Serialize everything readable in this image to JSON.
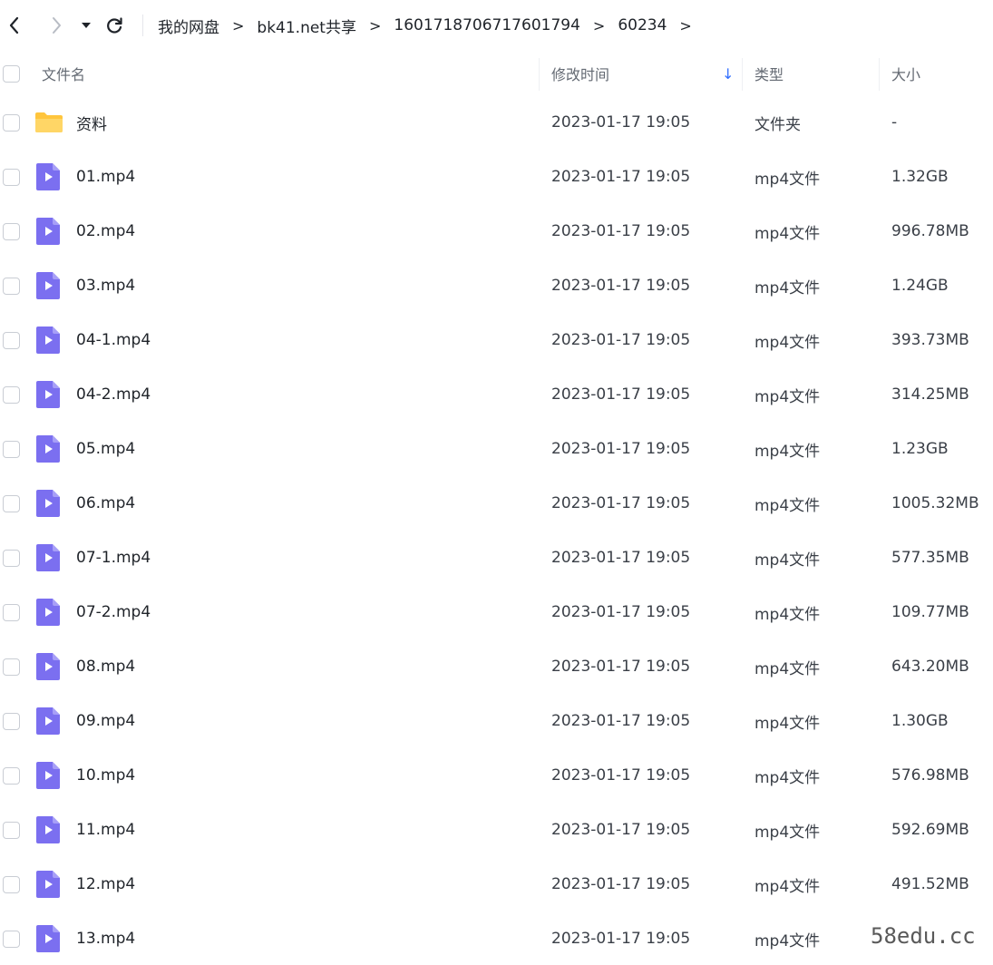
{
  "toolbar": {
    "back_icon": "chevron-left-icon",
    "forward_icon": "chevron-right-icon",
    "history_icon": "caret-down-icon",
    "refresh_icon": "refresh-icon"
  },
  "breadcrumb": {
    "items": [
      "我的网盘",
      "bk41.net共享",
      "1601718706717601794",
      "60234"
    ],
    "separator": ">"
  },
  "header": {
    "name": "文件名",
    "modified": "修改时间",
    "sort_icon": "arrow-down-icon",
    "sort_indicator": "↓",
    "type": "类型",
    "size": "大小"
  },
  "colors": {
    "accent": "#3370ff",
    "folder": "#ffc53d",
    "video_icon": "#7b6ff0"
  },
  "files": [
    {
      "name": "资料",
      "icon": "folder-icon",
      "modified": "2023-01-17 19:05",
      "type": "文件夹",
      "size": "-"
    },
    {
      "name": "01.mp4",
      "icon": "video-file-icon",
      "modified": "2023-01-17 19:05",
      "type": "mp4文件",
      "size": "1.32GB"
    },
    {
      "name": "02.mp4",
      "icon": "video-file-icon",
      "modified": "2023-01-17 19:05",
      "type": "mp4文件",
      "size": "996.78MB"
    },
    {
      "name": "03.mp4",
      "icon": "video-file-icon",
      "modified": "2023-01-17 19:05",
      "type": "mp4文件",
      "size": "1.24GB"
    },
    {
      "name": "04-1.mp4",
      "icon": "video-file-icon",
      "modified": "2023-01-17 19:05",
      "type": "mp4文件",
      "size": "393.73MB"
    },
    {
      "name": "04-2.mp4",
      "icon": "video-file-icon",
      "modified": "2023-01-17 19:05",
      "type": "mp4文件",
      "size": "314.25MB"
    },
    {
      "name": "05.mp4",
      "icon": "video-file-icon",
      "modified": "2023-01-17 19:05",
      "type": "mp4文件",
      "size": "1.23GB"
    },
    {
      "name": "06.mp4",
      "icon": "video-file-icon",
      "modified": "2023-01-17 19:05",
      "type": "mp4文件",
      "size": "1005.32MB"
    },
    {
      "name": "07-1.mp4",
      "icon": "video-file-icon",
      "modified": "2023-01-17 19:05",
      "type": "mp4文件",
      "size": "577.35MB"
    },
    {
      "name": "07-2.mp4",
      "icon": "video-file-icon",
      "modified": "2023-01-17 19:05",
      "type": "mp4文件",
      "size": "109.77MB"
    },
    {
      "name": "08.mp4",
      "icon": "video-file-icon",
      "modified": "2023-01-17 19:05",
      "type": "mp4文件",
      "size": "643.20MB"
    },
    {
      "name": "09.mp4",
      "icon": "video-file-icon",
      "modified": "2023-01-17 19:05",
      "type": "mp4文件",
      "size": "1.30GB"
    },
    {
      "name": "10.mp4",
      "icon": "video-file-icon",
      "modified": "2023-01-17 19:05",
      "type": "mp4文件",
      "size": "576.98MB"
    },
    {
      "name": "11.mp4",
      "icon": "video-file-icon",
      "modified": "2023-01-17 19:05",
      "type": "mp4文件",
      "size": "592.69MB"
    },
    {
      "name": "12.mp4",
      "icon": "video-file-icon",
      "modified": "2023-01-17 19:05",
      "type": "mp4文件",
      "size": "491.52MB"
    },
    {
      "name": "13.mp4",
      "icon": "video-file-icon",
      "modified": "2023-01-17 19:05",
      "type": "mp4文件",
      "size": "-"
    }
  ],
  "watermark": "58edu.cc"
}
